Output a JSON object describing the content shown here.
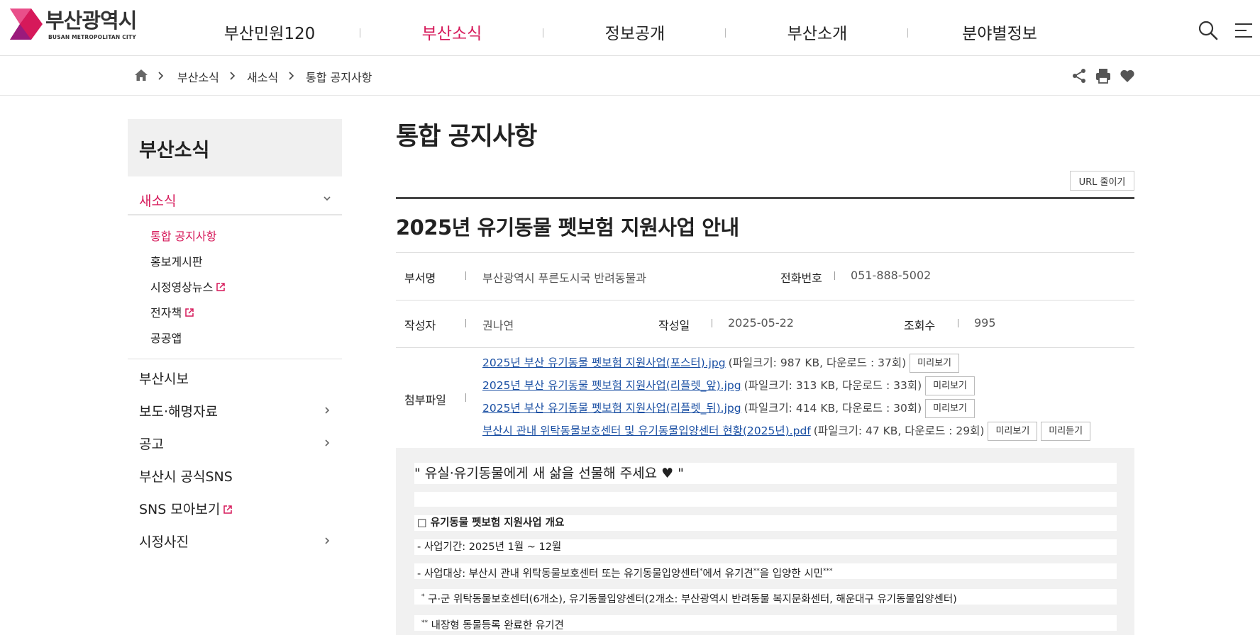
{
  "header": {
    "logo_ko": "부산광역시",
    "logo_en": "BUSAN METROPOLITAN CITY",
    "nav": [
      "부산민원120",
      "부산소식",
      "정보공개",
      "부산소개",
      "분야별정보"
    ],
    "active_nav": "부산소식",
    "accent": "#d6195a"
  },
  "breadcrumb": [
    "부산소식",
    "새소식",
    "통합 공지사항"
  ],
  "sidebar": {
    "title": "부산소식",
    "active_group": "새소식",
    "sub_items": [
      "통합 공지사항",
      "홍보게시판",
      "시정영상뉴스",
      "전자책",
      "공공앱"
    ],
    "items": [
      "부산시보",
      "보도·해명자료",
      "공고",
      "부산시 공식SNS",
      "SNS 모아보기",
      "시정사진"
    ]
  },
  "content": {
    "page_title": "통합 공지사항",
    "url_button": "URL 줄이기",
    "post_title": "2025년 유기동물 펫보험 지원사업 안내",
    "meta": {
      "dept_label": "부서명",
      "dept_value": "부산광역시 푸른도시국 반려동물과",
      "phone_label": "전화번호",
      "phone_value": "051-888-5002",
      "author_label": "작성자",
      "author_value": "권나연",
      "date_label": "작성일",
      "date_value": "2025-05-22",
      "views_label": "조회수",
      "views_value": "995",
      "files_label": "첨부파일"
    },
    "files": [
      {
        "name": "2025년 부산 유기동물 펫보험 지원사업(포스터).jpg",
        "info": "(파일크기: 987 KB, 다운로드 : 37회)",
        "preview": "미리보기"
      },
      {
        "name": "2025년 부산 유기동물 펫보험 지원사업(리플렛_앞).jpg",
        "info": "(파일크기: 313 KB, 다운로드 : 33회)",
        "preview": "미리보기"
      },
      {
        "name": "2025년 부산 유기동물 펫보험 지원사업(리플렛_뒤).jpg",
        "info": "(파일크기: 414 KB, 다운로드 : 30회)",
        "preview": "미리보기"
      },
      {
        "name": "부산시 관내 위탁동물보호센터 및 유기동물입양센터 현황(2025년).pdf",
        "info": "(파일크기: 47 KB, 다운로드 : 29회)",
        "preview": "미리보기",
        "listen": "미리듣기"
      }
    ],
    "body": {
      "lead": "\" 유실·유기동물에게 새 삶을 선물해 주세요 ♥ \"",
      "heading": "□ 유기동물 펫보험 지원사업 개요",
      "period": "- 사업기간: 2025년 1월 ~ 12월",
      "target_a": "- 사업대상: 부산시 관내 위탁동물보호센터 또는 유기동물입양센터",
      "target_b": "에서 유기견",
      "target_c": "을 입양한 시민",
      "note1": " 구·군 위탁동물보호센터(6개소), 유기동물입양센터(2개소: 부산광역시 반려동물 복지문화센터, 해운대구 유기동물입양센터)",
      "note2": " 내장형 동물등록 완료한 유기견",
      "mark1": "*",
      "mark2": "**",
      "mark3": "***"
    }
  }
}
